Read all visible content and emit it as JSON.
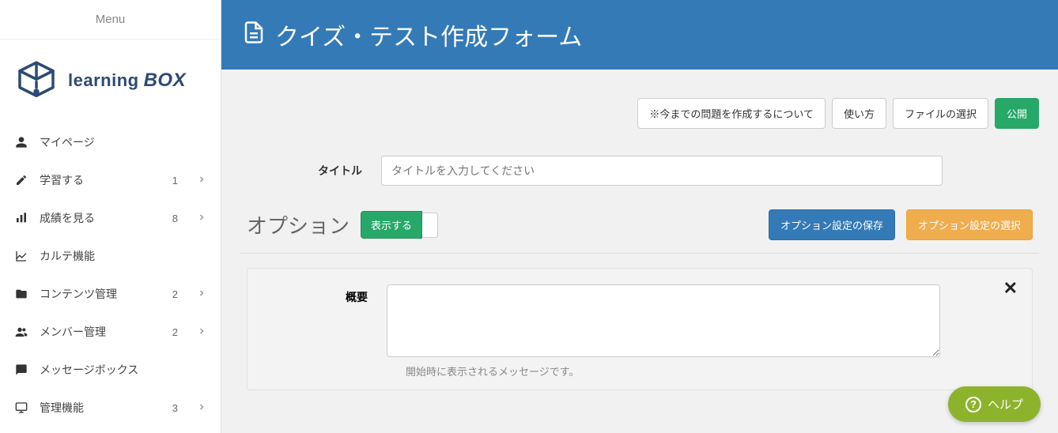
{
  "sidebar": {
    "menu_label": "Menu",
    "logo": {
      "t1": "learning",
      "t2": "BOX"
    },
    "items": [
      {
        "icon": "user",
        "label": "マイページ",
        "badge": "",
        "has_children": false
      },
      {
        "icon": "pencil",
        "label": "学習する",
        "badge": "1",
        "has_children": true
      },
      {
        "icon": "bars",
        "label": "成績を見る",
        "badge": "8",
        "has_children": true
      },
      {
        "icon": "chart",
        "label": "カルテ機能",
        "badge": "",
        "has_children": false
      },
      {
        "icon": "folder",
        "label": "コンテンツ管理",
        "badge": "2",
        "has_children": true
      },
      {
        "icon": "users",
        "label": "メンバー管理",
        "badge": "2",
        "has_children": true
      },
      {
        "icon": "message",
        "label": "メッセージボックス",
        "badge": "",
        "has_children": false
      },
      {
        "icon": "monitor",
        "label": "管理機能",
        "badge": "3",
        "has_children": true
      }
    ]
  },
  "header": {
    "title": "クイズ・テスト作成フォーム"
  },
  "toolbar": {
    "info": "※今までの問題を作成するについて",
    "usage": "使い方",
    "file_select": "ファイルの選択",
    "publish": "公開"
  },
  "title_field": {
    "label": "タイトル",
    "placeholder": "タイトルを入力してください",
    "value": ""
  },
  "options": {
    "heading": "オプション",
    "toggle_label": "表示する",
    "save_btn": "オプション設定の保存",
    "select_btn": "オプション設定の選択"
  },
  "summary_panel": {
    "label": "概要",
    "value": "",
    "help": "開始時に表示されるメッセージです。"
  },
  "help_fab": "ヘルプ"
}
